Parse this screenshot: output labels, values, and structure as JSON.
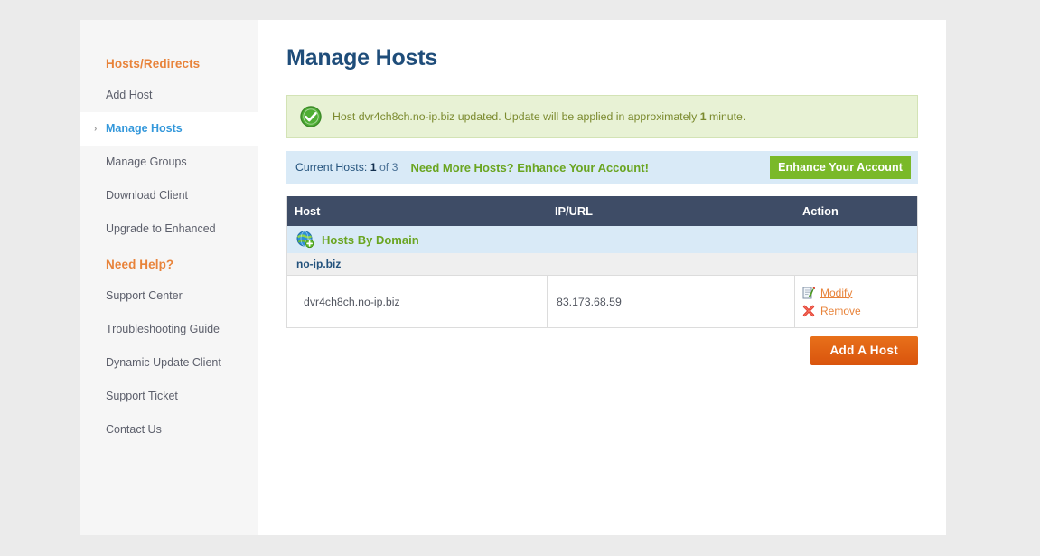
{
  "sidebar": {
    "sections": [
      {
        "heading": "Hosts/Redirects",
        "items": [
          {
            "label": "Add Host",
            "active": false
          },
          {
            "label": "Manage Hosts",
            "active": true
          },
          {
            "label": "Manage Groups",
            "active": false
          },
          {
            "label": "Download Client",
            "active": false
          },
          {
            "label": "Upgrade to Enhanced",
            "active": false
          }
        ]
      },
      {
        "heading": "Need Help?",
        "items": [
          {
            "label": "Support Center",
            "active": false
          },
          {
            "label": "Troubleshooting Guide",
            "active": false
          },
          {
            "label": "Dynamic Update Client",
            "active": false
          },
          {
            "label": "Support Ticket",
            "active": false
          },
          {
            "label": "Contact Us",
            "active": false
          }
        ]
      }
    ],
    "active_marker": "›"
  },
  "main": {
    "title": "Manage Hosts",
    "alert": {
      "icon": "success-check-icon",
      "text_before": "Host dvr4ch8ch.no-ip.biz updated. Update will be applied in approximately ",
      "text_bold": "1",
      "text_after": " minute."
    },
    "infobar": {
      "label": "Current Hosts:",
      "count": "1",
      "of": "of 3",
      "promo_text": "Need More Hosts? Enhance Your Account!",
      "button_label": "Enhance Your Account"
    },
    "table": {
      "columns": [
        "Host",
        "IP/URL",
        "Action"
      ],
      "group": {
        "icon": "globe-add-icon",
        "label": "Hosts By Domain",
        "domain": "no-ip.biz"
      },
      "rows": [
        {
          "host": "dvr4ch8ch.no-ip.biz",
          "ip": "83.173.68.59",
          "actions": [
            {
              "label": "Modify",
              "icon": "edit-document-icon"
            },
            {
              "label": "Remove",
              "icon": "red-x-icon"
            }
          ]
        }
      ]
    },
    "add_host_button": "Add A Host"
  },
  "colors": {
    "accent_orange": "#e8833a",
    "link_blue": "#3498db",
    "title_navy": "#1f4d7a",
    "green_button": "#7ab929",
    "orange_button": "#d9540d",
    "table_header": "#3e4c66",
    "alert_bg": "#e8f2d5",
    "info_bg": "#d9eaf7"
  }
}
